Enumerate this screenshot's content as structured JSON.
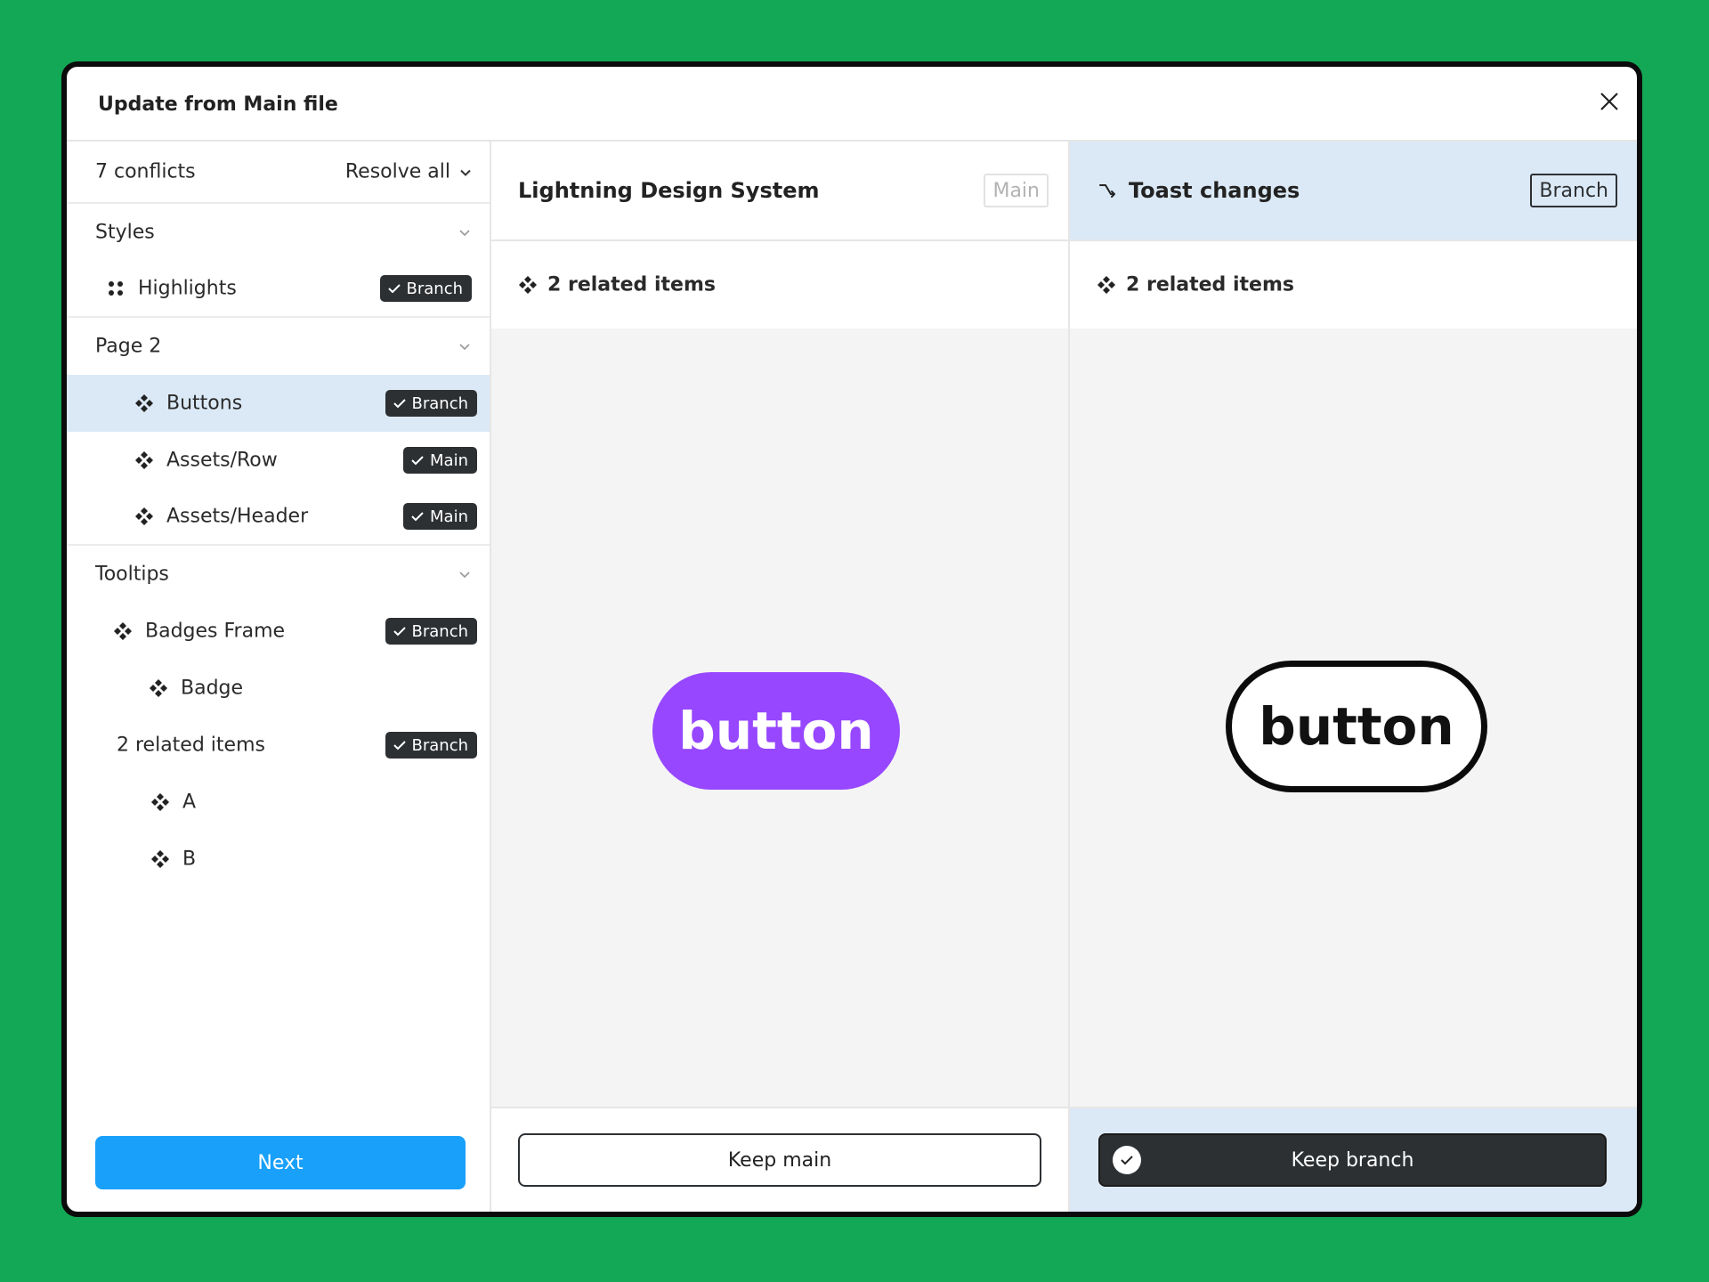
{
  "dialog": {
    "title": "Update from Main file"
  },
  "sidebar": {
    "conflicts_label": "7 conflicts",
    "resolve_all_label": "Resolve all",
    "groups": {
      "styles": "Styles",
      "page2": "Page 2",
      "tooltips": "Tooltips"
    },
    "items": [
      {
        "label": "Highlights",
        "badge": "Branch"
      },
      {
        "label": "Buttons",
        "badge": "Branch"
      },
      {
        "label": "Assets/Row",
        "badge": "Main"
      },
      {
        "label": "Assets/Header",
        "badge": "Main"
      },
      {
        "label": "Badges Frame",
        "badge": "Branch"
      },
      {
        "label": "Badge"
      },
      {
        "label": "2 related items",
        "badge": "Branch"
      },
      {
        "label": "A"
      },
      {
        "label": "B"
      }
    ],
    "next_label": "Next"
  },
  "main_pane": {
    "title": "Lightning Design System",
    "tag": "Main",
    "related": "2 related items",
    "preview_text": "button",
    "keep_label": "Keep main"
  },
  "branch_pane": {
    "title": "Toast changes",
    "tag": "Branch",
    "related": "2 related items",
    "preview_text": "button",
    "keep_label": "Keep branch"
  },
  "colors": {
    "background": "#12a855",
    "accent_blue": "#18a0fb",
    "selection": "#dbe9f6",
    "badge_dark": "#2d3033",
    "preview_purple": "#9747ff"
  }
}
